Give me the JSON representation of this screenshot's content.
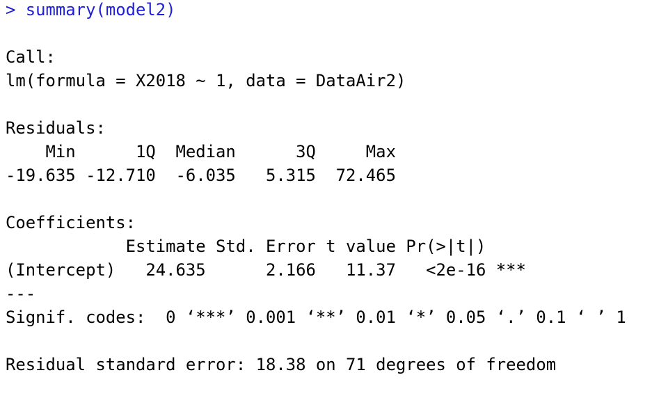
{
  "console": {
    "text_color": "#000000",
    "input_color": "#1f1fd6",
    "background": "#ffffff",
    "lines": [
      {
        "text": "> summary(model2)",
        "type": "input"
      },
      {
        "text": "",
        "type": "blank"
      },
      {
        "text": "Call:",
        "type": "output"
      },
      {
        "text": "lm(formula = X2018 ~ 1, data = DataAir2)",
        "type": "output"
      },
      {
        "text": "",
        "type": "blank"
      },
      {
        "text": "Residuals:",
        "type": "output"
      },
      {
        "text": "    Min      1Q  Median      3Q     Max ",
        "type": "output"
      },
      {
        "text": "-19.635 -12.710  -6.035   5.315  72.465 ",
        "type": "output"
      },
      {
        "text": "",
        "type": "blank"
      },
      {
        "text": "Coefficients:",
        "type": "output"
      },
      {
        "text": "            Estimate Std. Error t value Pr(>|t|)    ",
        "type": "output"
      },
      {
        "text": "(Intercept)   24.635      2.166   11.37   <2e-16 ***",
        "type": "output"
      },
      {
        "text": "---",
        "type": "output"
      },
      {
        "text": "Signif. codes:  0 ‘***’ 0.001 ‘**’ 0.01 ‘*’ 0.05 ‘.’ 0.1 ‘ ’ 1",
        "type": "output"
      },
      {
        "text": "",
        "type": "blank"
      },
      {
        "text": "Residual standard error: 18.38 on 71 degrees of freedom",
        "type": "output"
      }
    ]
  }
}
